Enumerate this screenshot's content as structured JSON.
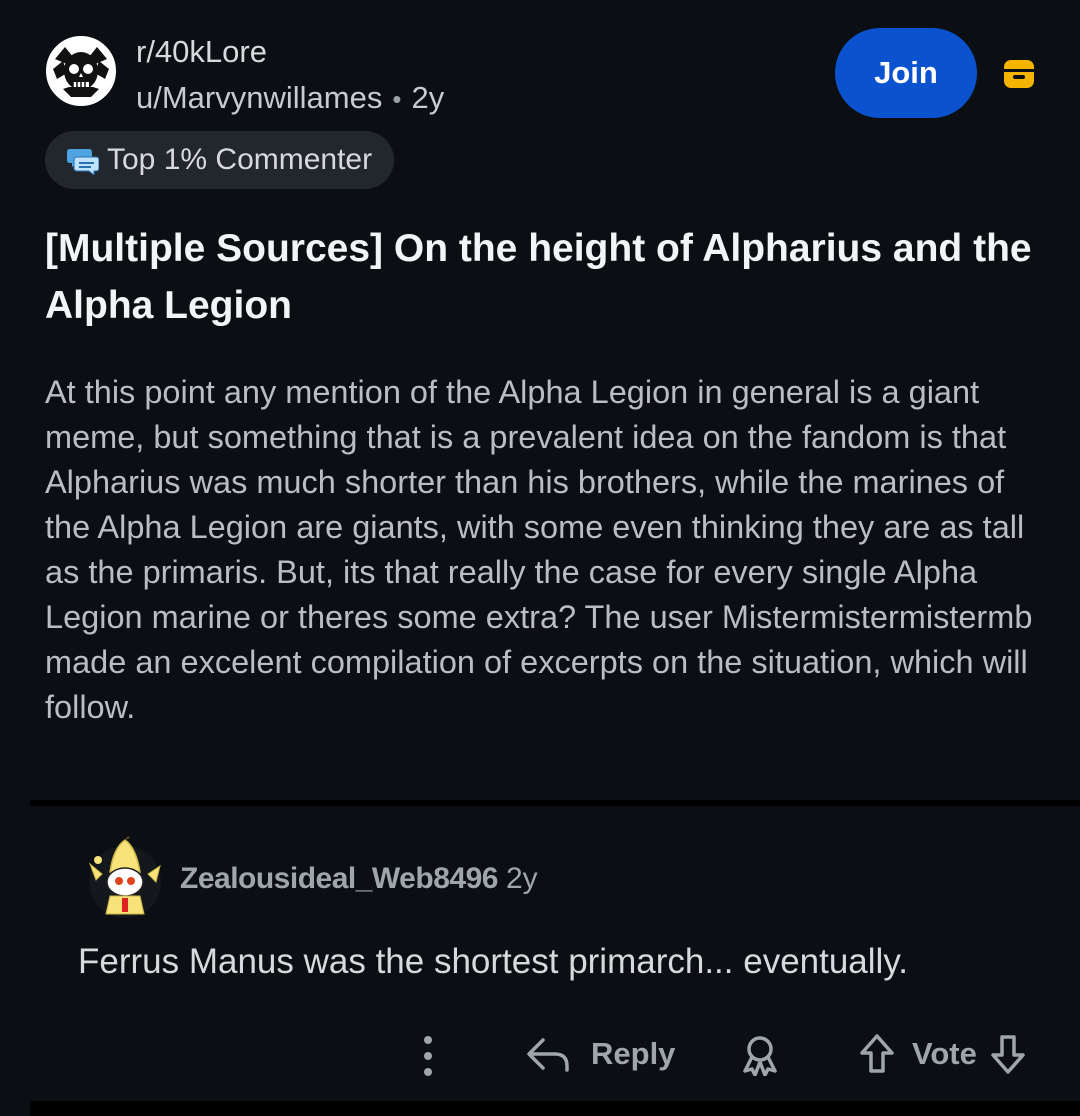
{
  "post": {
    "subreddit": "r/40kLore",
    "author": "u/Marvynwillames",
    "separator": "•",
    "age": "2y",
    "join_label": "Join",
    "flair": "Top 1% Commenter",
    "title": "[Multiple Sources] On the height of Alpharius and the Alpha Legion",
    "body": "At this point any mention of the Alpha Legion in general is a giant meme, but something that is a prevalent idea on the fandom is that Alpharius was much shorter than his brothers, while the marines of the Alpha Legion are giants, with some even thinking they are as tall as the primaris. But, its that really the case for every single Alpha Legion marine or theres some extra? The user Mistermistermistermb made an excelent compilation of excerpts on the situation, which will follow."
  },
  "comment": {
    "author": "Zealousideal_Web8496",
    "age": "2y",
    "body": "Ferrus Manus was the shortest primarch... eventually.",
    "reply_label": "Reply",
    "vote_label": "Vote"
  },
  "icons": {
    "subreddit_avatar": "skull-emblem-icon",
    "archive": "archive-box-icon",
    "flair": "chat-bubbles-icon",
    "comment_avatar": "banana-snoo-icon",
    "more": "vertical-dots-icon",
    "reply": "reply-arrow-icon",
    "award": "award-icon",
    "upvote": "upvote-arrow-icon",
    "downvote": "downvote-arrow-icon"
  },
  "colors": {
    "background": "#0b0e12",
    "join_button": "#0b53ce",
    "archive_icon": "#f5b400",
    "flair_bg": "#22272d",
    "divider": "#000000"
  }
}
